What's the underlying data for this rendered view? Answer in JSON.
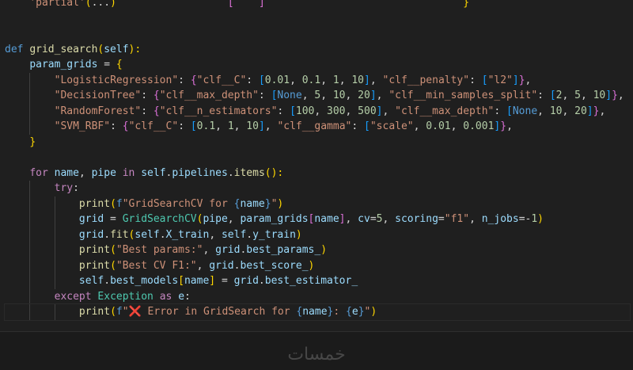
{
  "editor": {
    "lines": [
      [
        {
          "t": "    ",
          "c": "pun"
        },
        {
          "t": "'partial'",
          "c": "str"
        },
        {
          "t": "(",
          "c": "brk"
        },
        {
          "t": "...",
          "c": "pun"
        },
        {
          "t": ")",
          "c": "brk"
        },
        {
          "t": "                  ",
          "c": "pun"
        },
        {
          "t": "[",
          "c": "brk2"
        },
        {
          "t": "    ",
          "c": "pun"
        },
        {
          "t": "]",
          "c": "brk2"
        },
        {
          "t": "                                ",
          "c": "pun"
        },
        {
          "t": "}",
          "c": "brk"
        }
      ],
      [],
      [],
      [
        {
          "t": "def",
          "c": "kw"
        },
        {
          "t": " ",
          "c": "pun"
        },
        {
          "t": "grid_search",
          "c": "fn"
        },
        {
          "t": "(",
          "c": "brk"
        },
        {
          "t": "self",
          "c": "var"
        },
        {
          "t": "):",
          "c": "brk"
        }
      ],
      [
        {
          "t": "    ",
          "c": "pun"
        },
        {
          "t": "param_grids",
          "c": "var"
        },
        {
          "t": " = ",
          "c": "pun"
        },
        {
          "t": "{",
          "c": "brk"
        }
      ],
      [
        {
          "t": "        ",
          "c": "pun"
        },
        {
          "t": "\"LogisticRegression\"",
          "c": "str"
        },
        {
          "t": ": ",
          "c": "pun"
        },
        {
          "t": "{",
          "c": "brk2"
        },
        {
          "t": "\"clf__C\"",
          "c": "str"
        },
        {
          "t": ": ",
          "c": "pun"
        },
        {
          "t": "[",
          "c": "brk3"
        },
        {
          "t": "0.01",
          "c": "num"
        },
        {
          "t": ", ",
          "c": "pun"
        },
        {
          "t": "0.1",
          "c": "num"
        },
        {
          "t": ", ",
          "c": "pun"
        },
        {
          "t": "1",
          "c": "num"
        },
        {
          "t": ", ",
          "c": "pun"
        },
        {
          "t": "10",
          "c": "num"
        },
        {
          "t": "]",
          "c": "brk3"
        },
        {
          "t": ", ",
          "c": "pun"
        },
        {
          "t": "\"clf__penalty\"",
          "c": "str"
        },
        {
          "t": ": ",
          "c": "pun"
        },
        {
          "t": "[",
          "c": "brk3"
        },
        {
          "t": "\"l2\"",
          "c": "str"
        },
        {
          "t": "]",
          "c": "brk3"
        },
        {
          "t": "}",
          "c": "brk2"
        },
        {
          "t": ",",
          "c": "pun"
        }
      ],
      [
        {
          "t": "        ",
          "c": "pun"
        },
        {
          "t": "\"DecisionTree\"",
          "c": "str"
        },
        {
          "t": ": ",
          "c": "pun"
        },
        {
          "t": "{",
          "c": "brk2"
        },
        {
          "t": "\"clf__max_depth\"",
          "c": "str"
        },
        {
          "t": ": ",
          "c": "pun"
        },
        {
          "t": "[",
          "c": "brk3"
        },
        {
          "t": "None",
          "c": "kw"
        },
        {
          "t": ", ",
          "c": "pun"
        },
        {
          "t": "5",
          "c": "num"
        },
        {
          "t": ", ",
          "c": "pun"
        },
        {
          "t": "10",
          "c": "num"
        },
        {
          "t": ", ",
          "c": "pun"
        },
        {
          "t": "20",
          "c": "num"
        },
        {
          "t": "]",
          "c": "brk3"
        },
        {
          "t": ", ",
          "c": "pun"
        },
        {
          "t": "\"clf__min_samples_split\"",
          "c": "str"
        },
        {
          "t": ": ",
          "c": "pun"
        },
        {
          "t": "[",
          "c": "brk3"
        },
        {
          "t": "2",
          "c": "num"
        },
        {
          "t": ", ",
          "c": "pun"
        },
        {
          "t": "5",
          "c": "num"
        },
        {
          "t": ", ",
          "c": "pun"
        },
        {
          "t": "10",
          "c": "num"
        },
        {
          "t": "]",
          "c": "brk3"
        },
        {
          "t": "}",
          "c": "brk2"
        },
        {
          "t": ",",
          "c": "pun"
        }
      ],
      [
        {
          "t": "        ",
          "c": "pun"
        },
        {
          "t": "\"RandomForest\"",
          "c": "str"
        },
        {
          "t": ": ",
          "c": "pun"
        },
        {
          "t": "{",
          "c": "brk2"
        },
        {
          "t": "\"clf__n_estimators\"",
          "c": "str"
        },
        {
          "t": ": ",
          "c": "pun"
        },
        {
          "t": "[",
          "c": "brk3"
        },
        {
          "t": "100",
          "c": "num"
        },
        {
          "t": ", ",
          "c": "pun"
        },
        {
          "t": "300",
          "c": "num"
        },
        {
          "t": ", ",
          "c": "pun"
        },
        {
          "t": "500",
          "c": "num"
        },
        {
          "t": "]",
          "c": "brk3"
        },
        {
          "t": ", ",
          "c": "pun"
        },
        {
          "t": "\"clf__max_depth\"",
          "c": "str"
        },
        {
          "t": ": ",
          "c": "pun"
        },
        {
          "t": "[",
          "c": "brk3"
        },
        {
          "t": "None",
          "c": "kw"
        },
        {
          "t": ", ",
          "c": "pun"
        },
        {
          "t": "10",
          "c": "num"
        },
        {
          "t": ", ",
          "c": "pun"
        },
        {
          "t": "20",
          "c": "num"
        },
        {
          "t": "]",
          "c": "brk3"
        },
        {
          "t": "}",
          "c": "brk2"
        },
        {
          "t": ",",
          "c": "pun"
        }
      ],
      [
        {
          "t": "        ",
          "c": "pun"
        },
        {
          "t": "\"SVM_RBF\"",
          "c": "str"
        },
        {
          "t": ": ",
          "c": "pun"
        },
        {
          "t": "{",
          "c": "brk2"
        },
        {
          "t": "\"clf__C\"",
          "c": "str"
        },
        {
          "t": ": ",
          "c": "pun"
        },
        {
          "t": "[",
          "c": "brk3"
        },
        {
          "t": "0.1",
          "c": "num"
        },
        {
          "t": ", ",
          "c": "pun"
        },
        {
          "t": "1",
          "c": "num"
        },
        {
          "t": ", ",
          "c": "pun"
        },
        {
          "t": "10",
          "c": "num"
        },
        {
          "t": "]",
          "c": "brk3"
        },
        {
          "t": ", ",
          "c": "pun"
        },
        {
          "t": "\"clf__gamma\"",
          "c": "str"
        },
        {
          "t": ": ",
          "c": "pun"
        },
        {
          "t": "[",
          "c": "brk3"
        },
        {
          "t": "\"scale\"",
          "c": "str"
        },
        {
          "t": ", ",
          "c": "pun"
        },
        {
          "t": "0.01",
          "c": "num"
        },
        {
          "t": ", ",
          "c": "pun"
        },
        {
          "t": "0.001",
          "c": "num"
        },
        {
          "t": "]",
          "c": "brk3"
        },
        {
          "t": "}",
          "c": "brk2"
        },
        {
          "t": ",",
          "c": "pun"
        }
      ],
      [
        {
          "t": "    ",
          "c": "pun"
        },
        {
          "t": "}",
          "c": "brk"
        }
      ],
      [],
      [
        {
          "t": "    ",
          "c": "pun"
        },
        {
          "t": "for",
          "c": "ctl"
        },
        {
          "t": " ",
          "c": "pun"
        },
        {
          "t": "name",
          "c": "var"
        },
        {
          "t": ", ",
          "c": "pun"
        },
        {
          "t": "pipe",
          "c": "var"
        },
        {
          "t": " ",
          "c": "pun"
        },
        {
          "t": "in",
          "c": "ctl"
        },
        {
          "t": " ",
          "c": "pun"
        },
        {
          "t": "self",
          "c": "var"
        },
        {
          "t": ".",
          "c": "pun"
        },
        {
          "t": "pipelines",
          "c": "var"
        },
        {
          "t": ".",
          "c": "pun"
        },
        {
          "t": "items",
          "c": "fn"
        },
        {
          "t": "():",
          "c": "brk"
        }
      ],
      [
        {
          "t": "        ",
          "c": "pun"
        },
        {
          "t": "try",
          "c": "ctl"
        },
        {
          "t": ":",
          "c": "pun"
        }
      ],
      [
        {
          "t": "            ",
          "c": "pun"
        },
        {
          "t": "print",
          "c": "fn"
        },
        {
          "t": "(",
          "c": "brk"
        },
        {
          "t": "f",
          "c": "kw"
        },
        {
          "t": "\"GridSearchCV for ",
          "c": "str"
        },
        {
          "t": "{",
          "c": "kw"
        },
        {
          "t": "name",
          "c": "var"
        },
        {
          "t": "}",
          "c": "kw"
        },
        {
          "t": "\"",
          "c": "str"
        },
        {
          "t": ")",
          "c": "brk"
        }
      ],
      [
        {
          "t": "            ",
          "c": "pun"
        },
        {
          "t": "grid",
          "c": "var"
        },
        {
          "t": " = ",
          "c": "pun"
        },
        {
          "t": "GridSearchCV",
          "c": "cls"
        },
        {
          "t": "(",
          "c": "brk"
        },
        {
          "t": "pipe",
          "c": "var"
        },
        {
          "t": ", ",
          "c": "pun"
        },
        {
          "t": "param_grids",
          "c": "var"
        },
        {
          "t": "[",
          "c": "brk2"
        },
        {
          "t": "name",
          "c": "var"
        },
        {
          "t": "]",
          "c": "brk2"
        },
        {
          "t": ", ",
          "c": "pun"
        },
        {
          "t": "cv",
          "c": "var"
        },
        {
          "t": "=",
          "c": "pun"
        },
        {
          "t": "5",
          "c": "num"
        },
        {
          "t": ", ",
          "c": "pun"
        },
        {
          "t": "scoring",
          "c": "var"
        },
        {
          "t": "=",
          "c": "pun"
        },
        {
          "t": "\"f1\"",
          "c": "str"
        },
        {
          "t": ", ",
          "c": "pun"
        },
        {
          "t": "n_jobs",
          "c": "var"
        },
        {
          "t": "=-",
          "c": "pun"
        },
        {
          "t": "1",
          "c": "num"
        },
        {
          "t": ")",
          "c": "brk"
        }
      ],
      [
        {
          "t": "            ",
          "c": "pun"
        },
        {
          "t": "grid",
          "c": "var"
        },
        {
          "t": ".",
          "c": "pun"
        },
        {
          "t": "fit",
          "c": "fn"
        },
        {
          "t": "(",
          "c": "brk"
        },
        {
          "t": "self",
          "c": "var"
        },
        {
          "t": ".",
          "c": "pun"
        },
        {
          "t": "X_train",
          "c": "var"
        },
        {
          "t": ", ",
          "c": "pun"
        },
        {
          "t": "self",
          "c": "var"
        },
        {
          "t": ".",
          "c": "pun"
        },
        {
          "t": "y_train",
          "c": "var"
        },
        {
          "t": ")",
          "c": "brk"
        }
      ],
      [
        {
          "t": "            ",
          "c": "pun"
        },
        {
          "t": "print",
          "c": "fn"
        },
        {
          "t": "(",
          "c": "brk"
        },
        {
          "t": "\"Best params:\"",
          "c": "str"
        },
        {
          "t": ", ",
          "c": "pun"
        },
        {
          "t": "grid",
          "c": "var"
        },
        {
          "t": ".",
          "c": "pun"
        },
        {
          "t": "best_params_",
          "c": "var"
        },
        {
          "t": ")",
          "c": "brk"
        }
      ],
      [
        {
          "t": "            ",
          "c": "pun"
        },
        {
          "t": "print",
          "c": "fn"
        },
        {
          "t": "(",
          "c": "brk"
        },
        {
          "t": "\"Best CV F1:\"",
          "c": "str"
        },
        {
          "t": ", ",
          "c": "pun"
        },
        {
          "t": "grid",
          "c": "var"
        },
        {
          "t": ".",
          "c": "pun"
        },
        {
          "t": "best_score_",
          "c": "var"
        },
        {
          "t": ")",
          "c": "brk"
        }
      ],
      [
        {
          "t": "            ",
          "c": "pun"
        },
        {
          "t": "self",
          "c": "var"
        },
        {
          "t": ".",
          "c": "pun"
        },
        {
          "t": "best_models",
          "c": "var"
        },
        {
          "t": "[",
          "c": "brk"
        },
        {
          "t": "name",
          "c": "var"
        },
        {
          "t": "]",
          "c": "brk"
        },
        {
          "t": " = ",
          "c": "pun"
        },
        {
          "t": "grid",
          "c": "var"
        },
        {
          "t": ".",
          "c": "pun"
        },
        {
          "t": "best_estimator_",
          "c": "var"
        }
      ],
      [
        {
          "t": "        ",
          "c": "pun"
        },
        {
          "t": "except",
          "c": "ctl"
        },
        {
          "t": " ",
          "c": "pun"
        },
        {
          "t": "Exception",
          "c": "cls"
        },
        {
          "t": " ",
          "c": "pun"
        },
        {
          "t": "as",
          "c": "ctl"
        },
        {
          "t": " ",
          "c": "pun"
        },
        {
          "t": "e",
          "c": "var"
        },
        {
          "t": ":",
          "c": "pun"
        }
      ],
      [
        {
          "t": "            ",
          "c": "pun"
        },
        {
          "t": "print",
          "c": "fn"
        },
        {
          "t": "(",
          "c": "brk"
        },
        {
          "t": "f",
          "c": "kw"
        },
        {
          "t": "\"",
          "c": "str"
        },
        {
          "t": "❌",
          "c": "err"
        },
        {
          "t": " Error in GridSearch for ",
          "c": "str"
        },
        {
          "t": "{",
          "c": "kw"
        },
        {
          "t": "name",
          "c": "var"
        },
        {
          "t": "}",
          "c": "kw"
        },
        {
          "t": ": ",
          "c": "str"
        },
        {
          "t": "{",
          "c": "kw"
        },
        {
          "t": "e",
          "c": "var"
        },
        {
          "t": "}",
          "c": "kw"
        },
        {
          "t": "\"",
          "c": "str"
        },
        {
          "t": ")",
          "c": "brk"
        }
      ]
    ],
    "current_line": 20
  },
  "colors": {
    "background": "#1f1f1f",
    "keyword": "#569cd6",
    "control": "#c586c0",
    "function": "#dcdcaa",
    "class": "#4ec9b0",
    "variable": "#9cdcfe",
    "string": "#ce9178",
    "number": "#b5cea8",
    "bracket_gold": "#ffd700",
    "bracket_orchid": "#da70d6",
    "bracket_blue": "#179fff"
  },
  "watermark": {
    "text": "خمسات"
  }
}
